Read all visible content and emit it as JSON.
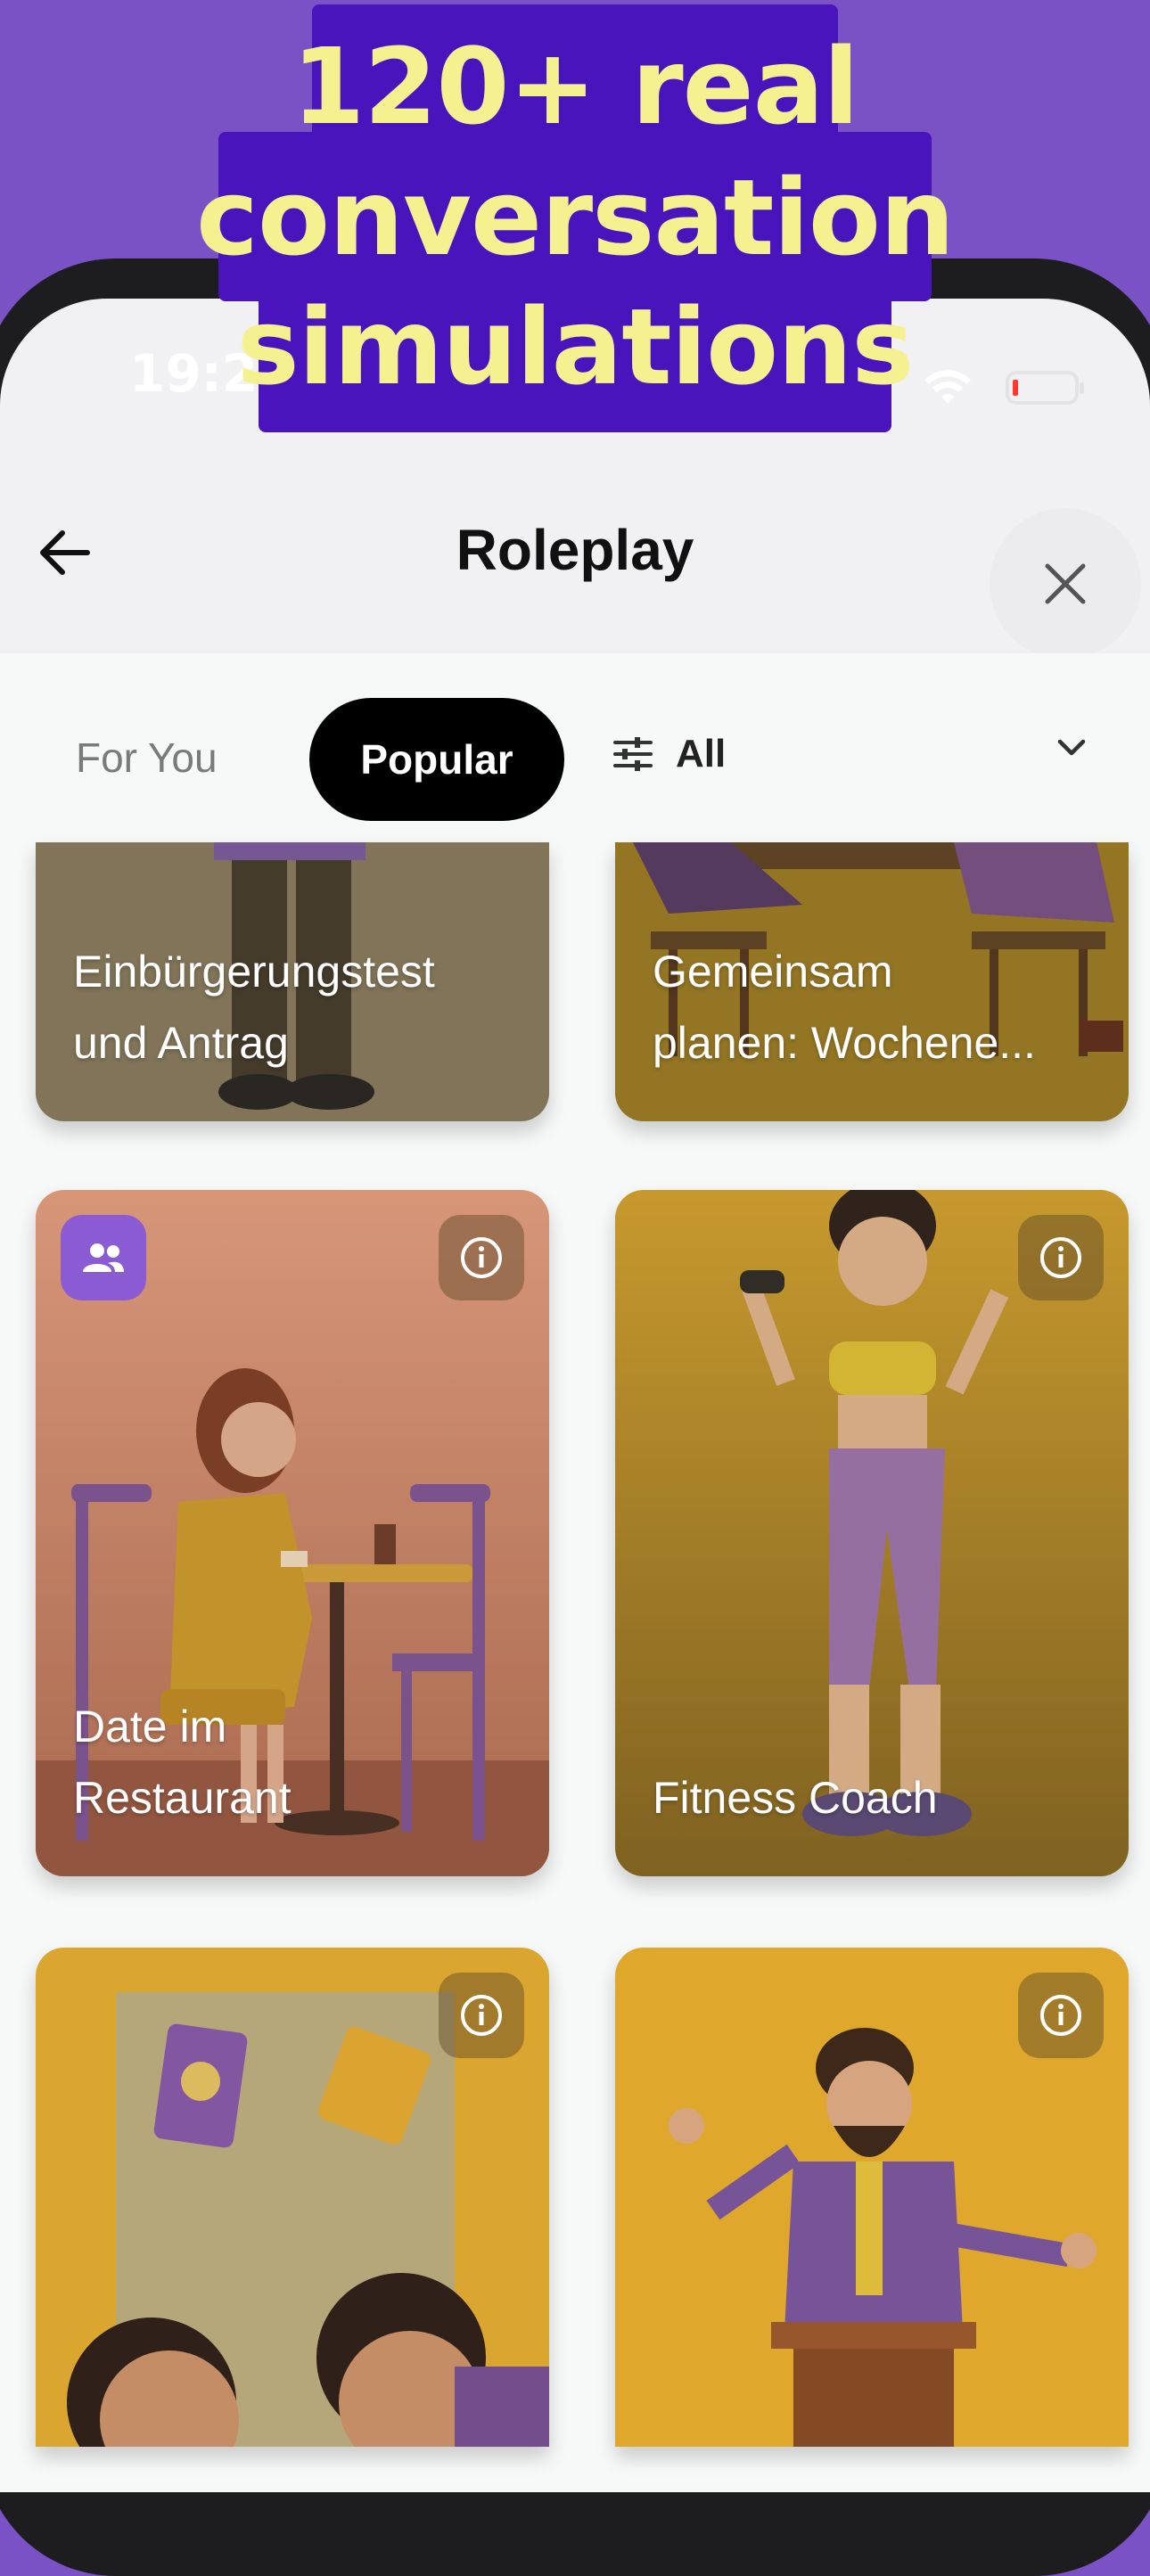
{
  "headline": {
    "line1": "120+ real",
    "line2": "conversation",
    "line3": "simulations"
  },
  "status_bar": {
    "time": "19:25"
  },
  "header": {
    "title": "Roleplay",
    "back_icon": "arrow-left-icon",
    "close_icon": "close-icon"
  },
  "tabs": {
    "for_you": "For You",
    "popular": "Popular",
    "filter_label": "All",
    "filter_icon": "sliders-icon",
    "dropdown_icon": "chevron-down-icon"
  },
  "cards": [
    {
      "title_line1": "Einbürgerungstest",
      "title_line2": "und Antrag"
    },
    {
      "title_line1": "Gemeinsam",
      "title_line2": "planen: Wochene..."
    },
    {
      "title_line1": "Date im",
      "title_line2": "Restaurant",
      "group_icon": "group-icon",
      "info_icon": "info-icon"
    },
    {
      "title_line1": "",
      "title_line2": "Fitness Coach",
      "info_icon": "info-icon"
    },
    {
      "info_icon": "info-icon"
    },
    {
      "info_icon": "info-icon"
    }
  ],
  "colors": {
    "background_purple": "#7a52c6",
    "headline_box": "#4a14bd",
    "headline_text": "#f5f191",
    "tab_active_bg": "#000000",
    "card_restaurant": "#efa98a",
    "card_fitness": "#d9a52f",
    "card_bottom": "#f2b83a"
  }
}
